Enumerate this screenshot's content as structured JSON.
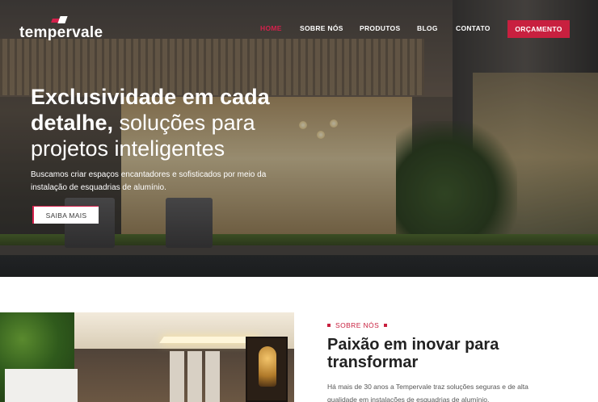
{
  "brand": {
    "name": "tempervale"
  },
  "nav": {
    "items": [
      "HOME",
      "SOBRE NÓS",
      "PRODUTOS",
      "BLOG",
      "CONTATO"
    ],
    "active": "HOME",
    "cta": "ORÇAMENTO"
  },
  "hero": {
    "title_bold_1": "Exclusividade em cada",
    "title_bold_2": "detalhe,",
    "title_light_2": " soluções para",
    "title_light_3": "projetos inteligentes",
    "subtitle_1": "Buscamos criar espaços encantadores e sofisticados por meio da",
    "subtitle_2": "instalação de esquadrias de alumínio.",
    "button": "SAIBA MAIS"
  },
  "about": {
    "tag": "SOBRE NÓS",
    "title_1": "Paixão em inovar para",
    "title_2": "transformar",
    "text_1": "Há mais de 30 anos a Tempervale traz soluções seguras e de alta",
    "text_2": "qualidade em instalações de esquadrias de alumínio."
  },
  "colors": {
    "accent": "#c8203f",
    "text_dark": "#222222",
    "text_muted": "#555555"
  }
}
